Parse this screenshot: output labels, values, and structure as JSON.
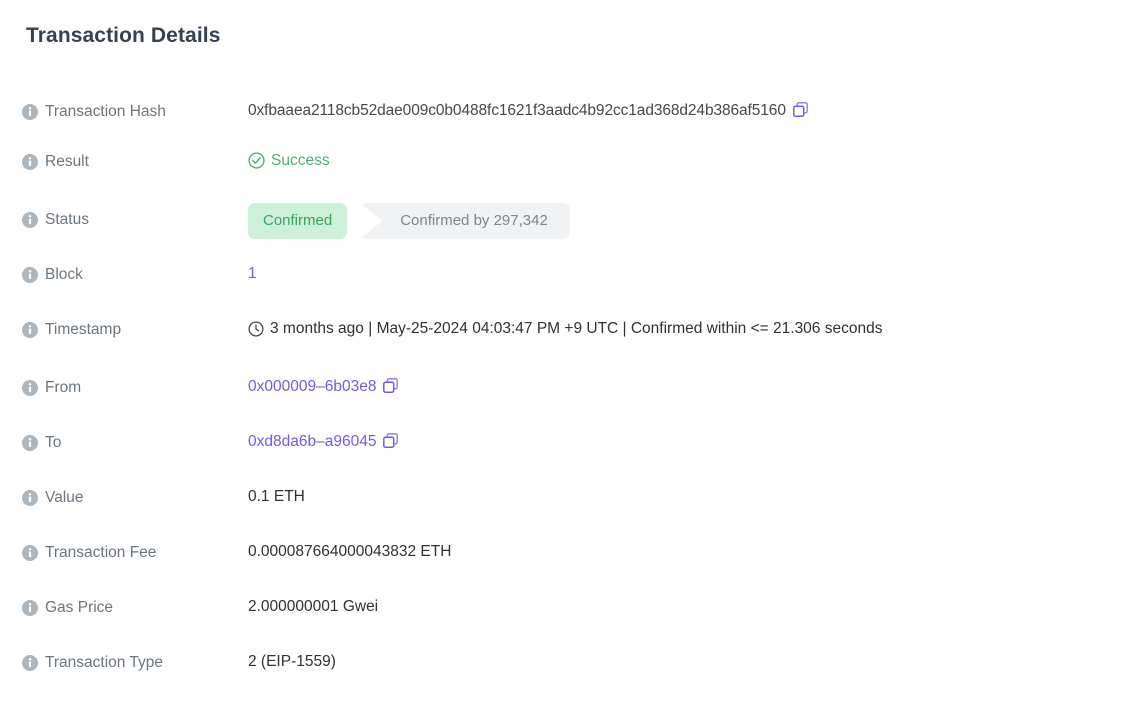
{
  "page": {
    "title": "Transaction Details"
  },
  "icons": {
    "info": "info-icon",
    "copy": "copy-icon",
    "success": "circle-check-icon",
    "clock": "clock-icon"
  },
  "colors": {
    "link_purple": "#6c5ce7",
    "success_green": "#4cb174",
    "badge_green_bg": "#cdf0d8",
    "badge_green_text": "#3f9f63",
    "badge_gray_bg": "#f1f2f4",
    "badge_gray_text": "#7c848c",
    "label_gray": "#6c757d",
    "title_dark": "#36424f"
  },
  "rows": {
    "transaction_hash": {
      "label": "Transaction Hash",
      "value": "0xfbaaea2118cb52dae009c0b0488fc1621f3aadc4b92cc1ad368d24b386af5160"
    },
    "result": {
      "label": "Result",
      "value": "Success"
    },
    "status": {
      "label": "Status",
      "badge_primary": "Confirmed",
      "badge_secondary": "Confirmed by 297,342"
    },
    "block": {
      "label": "Block",
      "value": "1"
    },
    "timestamp": {
      "label": "Timestamp",
      "value": "3 months ago | May-25-2024 04:03:47 PM +9 UTC | Confirmed within <= 21.306 seconds"
    },
    "from": {
      "label": "From",
      "value": "0x000009–6b03e8"
    },
    "to": {
      "label": "To",
      "value": "0xd8da6b–a96045"
    },
    "value": {
      "label": "Value",
      "value": "0.1 ETH"
    },
    "transaction_fee": {
      "label": "Transaction Fee",
      "value": "0.000087664000043832 ETH"
    },
    "gas_price": {
      "label": "Gas Price",
      "value": "2.000000001 Gwei"
    },
    "transaction_type": {
      "label": "Transaction Type",
      "value": "2 (EIP-1559)"
    }
  }
}
